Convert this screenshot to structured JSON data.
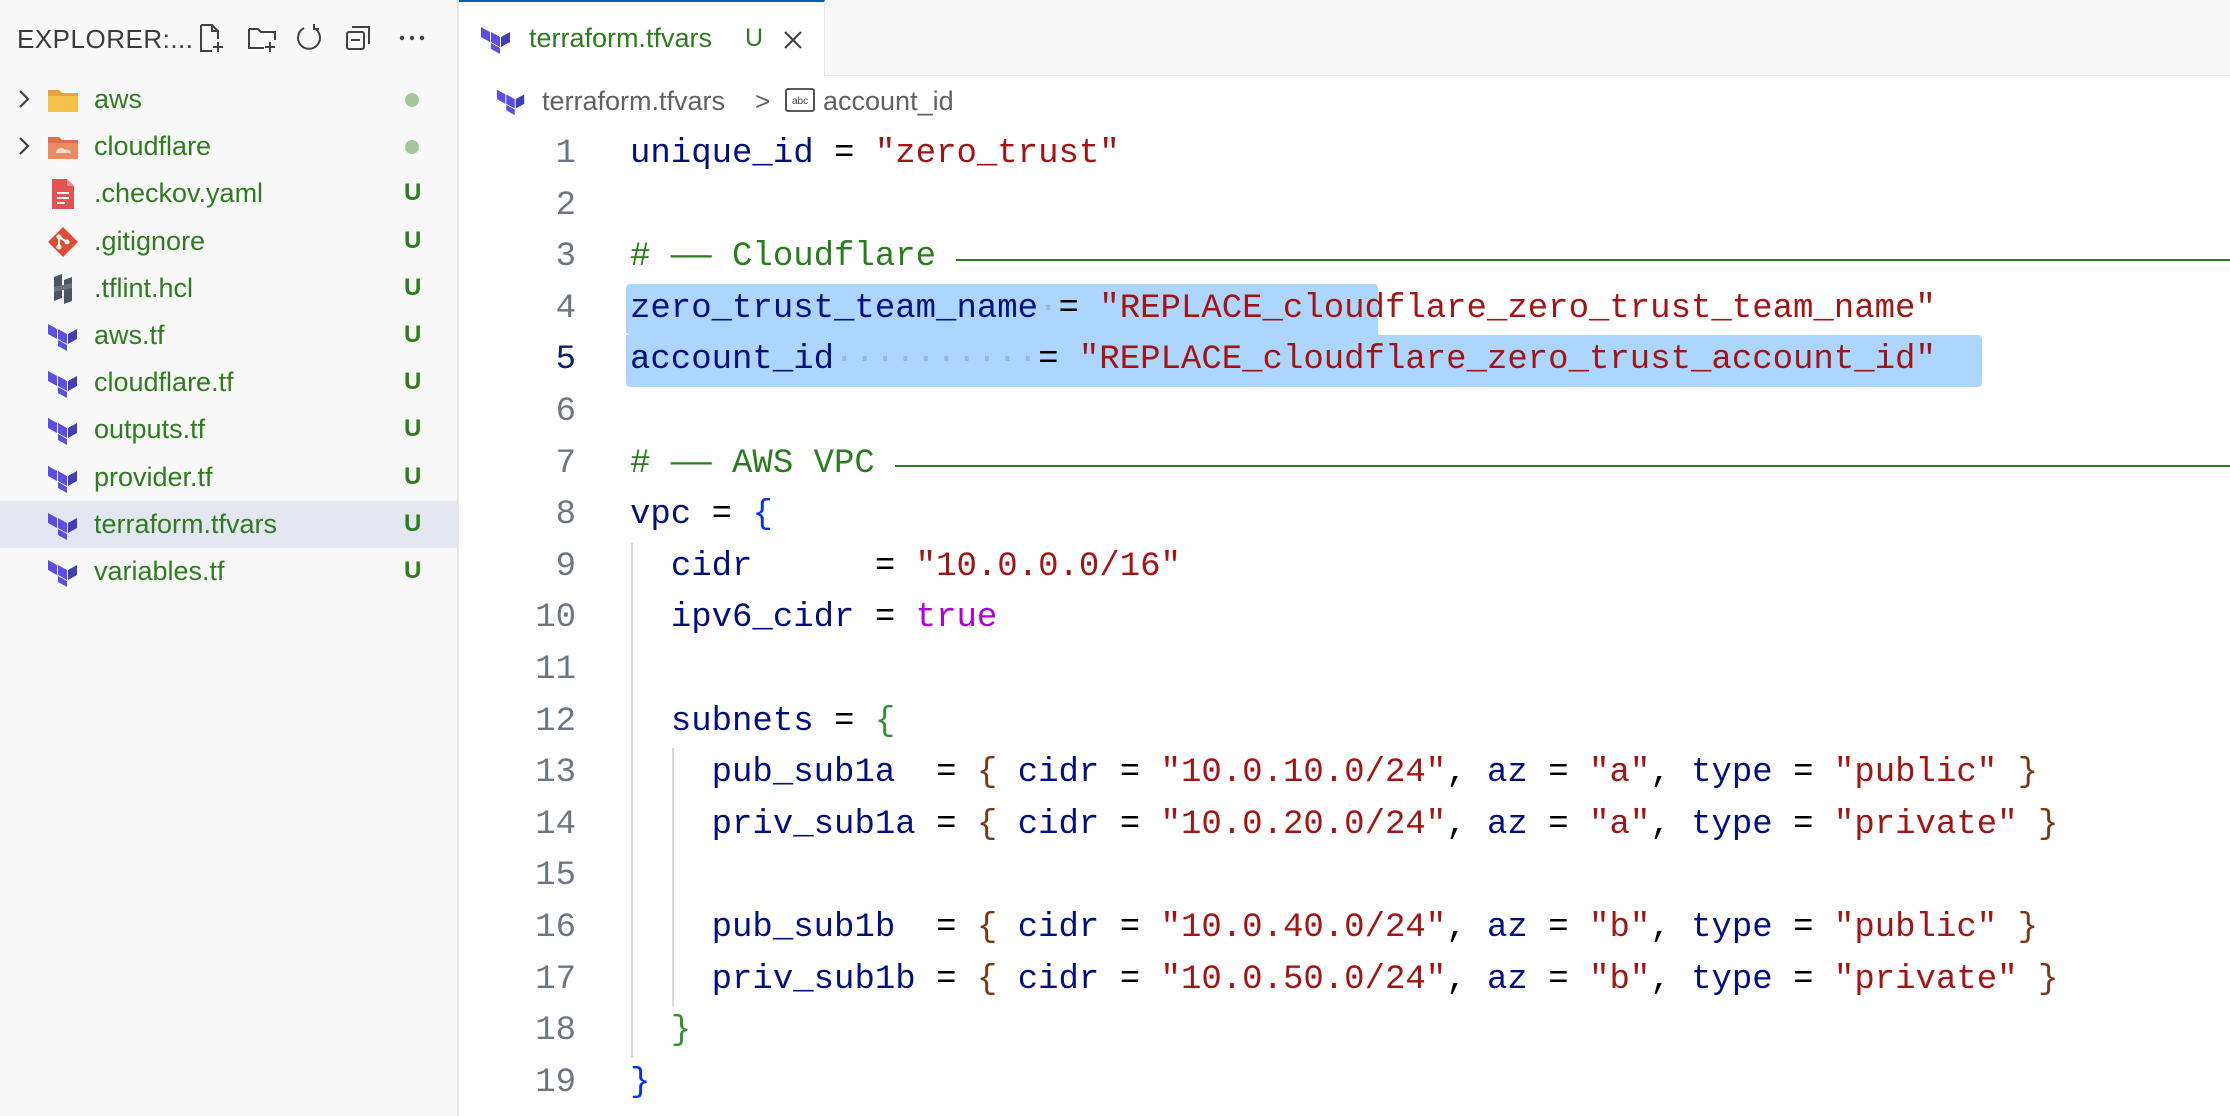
{
  "sidebar": {
    "title": "EXPLORER:...",
    "actions": [
      {
        "name": "new-file"
      },
      {
        "name": "new-folder"
      },
      {
        "name": "refresh"
      },
      {
        "name": "collapse-all"
      },
      {
        "name": "more-actions"
      }
    ],
    "items": [
      {
        "label": "aws",
        "kind": "folder",
        "icon": "folder-aws-icon",
        "status": "dot"
      },
      {
        "label": "cloudflare",
        "kind": "folder",
        "icon": "folder-cloudflare-icon",
        "status": "dot"
      },
      {
        "label": ".checkov.yaml",
        "kind": "file",
        "icon": "yaml-file-icon",
        "badge": "U"
      },
      {
        "label": ".gitignore",
        "kind": "file",
        "icon": "git-icon",
        "badge": "U"
      },
      {
        "label": ".tflint.hcl",
        "kind": "file",
        "icon": "hcl-icon",
        "badge": "U"
      },
      {
        "label": "aws.tf",
        "kind": "file",
        "icon": "terraform-icon",
        "badge": "U"
      },
      {
        "label": "cloudflare.tf",
        "kind": "file",
        "icon": "terraform-icon",
        "badge": "U"
      },
      {
        "label": "outputs.tf",
        "kind": "file",
        "icon": "terraform-icon",
        "badge": "U"
      },
      {
        "label": "provider.tf",
        "kind": "file",
        "icon": "terraform-icon",
        "badge": "U"
      },
      {
        "label": "terraform.tfvars",
        "kind": "file",
        "icon": "terraform-icon",
        "badge": "U",
        "selected": true
      },
      {
        "label": "variables.tf",
        "kind": "file",
        "icon": "terraform-icon",
        "badge": "U"
      }
    ]
  },
  "tab": {
    "label": "terraform.tfvars",
    "badge": "U"
  },
  "breadcrumb": {
    "file": "terraform.tfvars",
    "separator": ">",
    "symbol": "account_id"
  },
  "editor": {
    "active_line": 5,
    "lines": [
      {
        "n": "1",
        "tokens": [
          [
            "k",
            "unique_id"
          ],
          [
            "o",
            " = "
          ],
          [
            "s",
            "\"zero_trust\""
          ]
        ]
      },
      {
        "n": "2",
        "tokens": []
      },
      {
        "n": "3",
        "tokens": [
          [
            "c",
            "# —— Cloudflare "
          ]
        ],
        "rule": true
      },
      {
        "n": "4",
        "tokens": [
          [
            "k",
            "zero_trust_team_name"
          ],
          [
            "ws",
            "·"
          ],
          [
            "o",
            "= "
          ],
          [
            "s",
            "\"REPLACE_cloudflare_zero_trust_team_name\""
          ]
        ],
        "highlight": true
      },
      {
        "n": "5",
        "tokens": [
          [
            "k",
            "account_id"
          ],
          [
            "ws",
            "··········"
          ],
          [
            "o",
            "= "
          ],
          [
            "s",
            "\"REPLACE_cloudflare_zero_trust_account_id\""
          ]
        ],
        "highlight": true
      },
      {
        "n": "6",
        "tokens": []
      },
      {
        "n": "7",
        "tokens": [
          [
            "c",
            "# —— AWS VPC "
          ]
        ],
        "rule": true
      },
      {
        "n": "8",
        "tokens": [
          [
            "k",
            "vpc"
          ],
          [
            "o",
            " = "
          ],
          [
            "br1",
            "{"
          ]
        ]
      },
      {
        "n": "9",
        "tokens": [
          [
            "o",
            "  "
          ],
          [
            "k",
            "cidr"
          ],
          [
            "o",
            "      = "
          ],
          [
            "s",
            "\"10.0.0.0/16\""
          ]
        ]
      },
      {
        "n": "10",
        "tokens": [
          [
            "o",
            "  "
          ],
          [
            "k",
            "ipv6_cidr"
          ],
          [
            "o",
            " = "
          ],
          [
            "b",
            "true"
          ]
        ]
      },
      {
        "n": "11",
        "tokens": []
      },
      {
        "n": "12",
        "tokens": [
          [
            "o",
            "  "
          ],
          [
            "k",
            "subnets"
          ],
          [
            "o",
            " = "
          ],
          [
            "br2",
            "{"
          ]
        ]
      },
      {
        "n": "13",
        "tokens": [
          [
            "o",
            "    "
          ],
          [
            "k",
            "pub_sub1a"
          ],
          [
            "o",
            "  = "
          ],
          [
            "br3",
            "{"
          ],
          [
            "o",
            " "
          ],
          [
            "k",
            "cidr"
          ],
          [
            "o",
            " = "
          ],
          [
            "s",
            "\"10.0.10.0/24\""
          ],
          [
            "o",
            ", "
          ],
          [
            "k",
            "az"
          ],
          [
            "o",
            " = "
          ],
          [
            "s",
            "\"a\""
          ],
          [
            "o",
            ", "
          ],
          [
            "k",
            "type"
          ],
          [
            "o",
            " = "
          ],
          [
            "s",
            "\"public\""
          ],
          [
            "o",
            " "
          ],
          [
            "br3",
            "}"
          ]
        ]
      },
      {
        "n": "14",
        "tokens": [
          [
            "o",
            "    "
          ],
          [
            "k",
            "priv_sub1a"
          ],
          [
            "o",
            " = "
          ],
          [
            "br3",
            "{"
          ],
          [
            "o",
            " "
          ],
          [
            "k",
            "cidr"
          ],
          [
            "o",
            " = "
          ],
          [
            "s",
            "\"10.0.20.0/24\""
          ],
          [
            "o",
            ", "
          ],
          [
            "k",
            "az"
          ],
          [
            "o",
            " = "
          ],
          [
            "s",
            "\"a\""
          ],
          [
            "o",
            ", "
          ],
          [
            "k",
            "type"
          ],
          [
            "o",
            " = "
          ],
          [
            "s",
            "\"private\""
          ],
          [
            "o",
            " "
          ],
          [
            "br3",
            "}"
          ]
        ]
      },
      {
        "n": "15",
        "tokens": []
      },
      {
        "n": "16",
        "tokens": [
          [
            "o",
            "    "
          ],
          [
            "k",
            "pub_sub1b"
          ],
          [
            "o",
            "  = "
          ],
          [
            "br3",
            "{"
          ],
          [
            "o",
            " "
          ],
          [
            "k",
            "cidr"
          ],
          [
            "o",
            " = "
          ],
          [
            "s",
            "\"10.0.40.0/24\""
          ],
          [
            "o",
            ", "
          ],
          [
            "k",
            "az"
          ],
          [
            "o",
            " = "
          ],
          [
            "s",
            "\"b\""
          ],
          [
            "o",
            ", "
          ],
          [
            "k",
            "type"
          ],
          [
            "o",
            " = "
          ],
          [
            "s",
            "\"public\""
          ],
          [
            "o",
            " "
          ],
          [
            "br3",
            "}"
          ]
        ]
      },
      {
        "n": "17",
        "tokens": [
          [
            "o",
            "    "
          ],
          [
            "k",
            "priv_sub1b"
          ],
          [
            "o",
            " = "
          ],
          [
            "br3",
            "{"
          ],
          [
            "o",
            " "
          ],
          [
            "k",
            "cidr"
          ],
          [
            "o",
            " = "
          ],
          [
            "s",
            "\"10.0.50.0/24\""
          ],
          [
            "o",
            ", "
          ],
          [
            "k",
            "az"
          ],
          [
            "o",
            " = "
          ],
          [
            "s",
            "\"b\""
          ],
          [
            "o",
            ", "
          ],
          [
            "k",
            "type"
          ],
          [
            "o",
            " = "
          ],
          [
            "s",
            "\"private\""
          ],
          [
            "o",
            " "
          ],
          [
            "br3",
            "}"
          ]
        ]
      },
      {
        "n": "18",
        "tokens": [
          [
            "o",
            "  "
          ],
          [
            "br2",
            "}"
          ]
        ]
      },
      {
        "n": "19",
        "tokens": [
          [
            "br1",
            "}"
          ]
        ]
      }
    ]
  },
  "colors": {
    "accent": "#005fb8",
    "untracked": "#2d7d1d",
    "selection": "#add6ff",
    "selected_row": "#e4e6f1",
    "terraform": "#5c4ee5"
  }
}
